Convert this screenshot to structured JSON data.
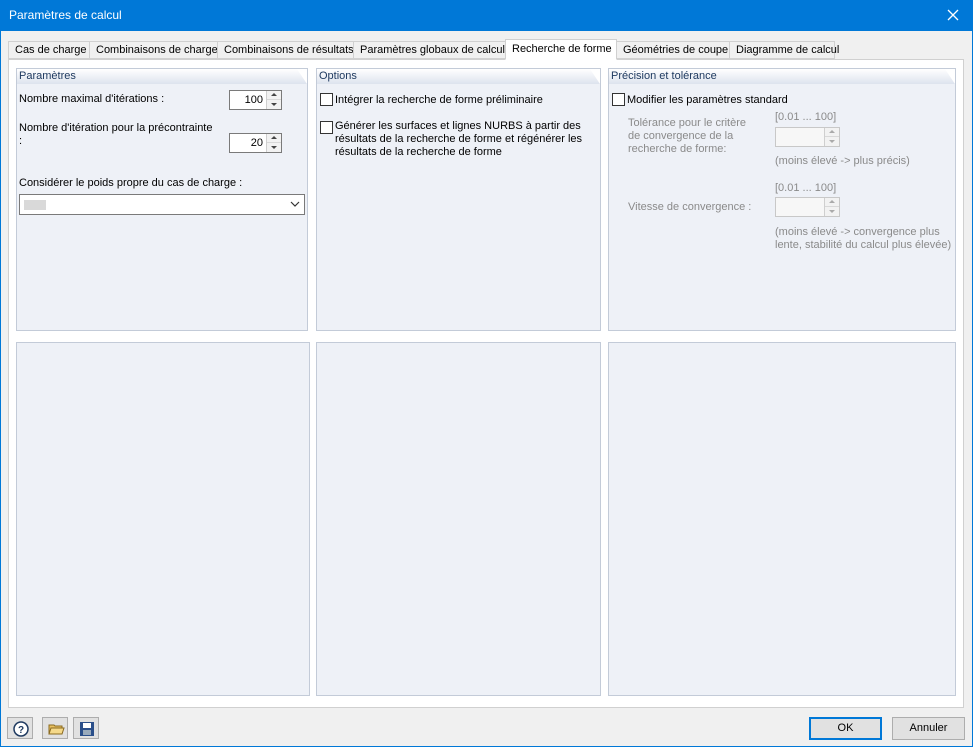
{
  "window": {
    "title": "Paramètres de calcul"
  },
  "tabs": [
    {
      "label": "Cas de charge"
    },
    {
      "label": "Combinaisons de charge"
    },
    {
      "label": "Combinaisons de résultats"
    },
    {
      "label": "Paramètres globaux de calcul"
    },
    {
      "label": "Recherche de forme"
    },
    {
      "label": "Géométries de coupe"
    },
    {
      "label": "Diagramme de calcul"
    }
  ],
  "active_tab": "Recherche de forme",
  "parametres": {
    "title": "Paramètres",
    "max_iterations_label": "Nombre maximal d'itérations :",
    "max_iterations_value": "100",
    "prestress_iterations_label": "Nombre d'itération pour la précontrainte\n:",
    "prestress_iterations_value": "20",
    "self_weight_label": "Considérer le poids propre du cas de charge :",
    "self_weight_value": ""
  },
  "options": {
    "title": "Options",
    "integrate_label": "Intégrer la recherche de forme préliminaire",
    "integrate_checked": false,
    "generate_nurbs_label": "Générer les surfaces et lignes NURBS à partir des résultats de la recherche de forme et régénérer les résultats de la recherche de forme",
    "generate_nurbs_checked": false
  },
  "precision": {
    "title": "Précision et tolérance",
    "modify_label": "Modifier les paramètres standard",
    "modify_checked": false,
    "tolerance_range": "[0.01 ... 100]",
    "tolerance_label": "Tolérance pour le critère de convergence de la recherche de forme:",
    "tolerance_value": "",
    "tolerance_hint": "(moins élevé -> plus précis)",
    "speed_range": "[0.01 ... 100]",
    "speed_label": "Vitesse de convergence :",
    "speed_value": "",
    "speed_hint": "(moins élevé -> convergence plus lente, stabilité du calcul plus élevée)"
  },
  "footer": {
    "ok_label": "OK",
    "cancel_label": "Annuler",
    "icons": [
      "help-icon",
      "open-folder-icon",
      "save-icon"
    ]
  },
  "colors": {
    "titlebar": "#0078d7",
    "panel_bg": "#eef1f7",
    "panel_head_text": "#1f3a60"
  }
}
